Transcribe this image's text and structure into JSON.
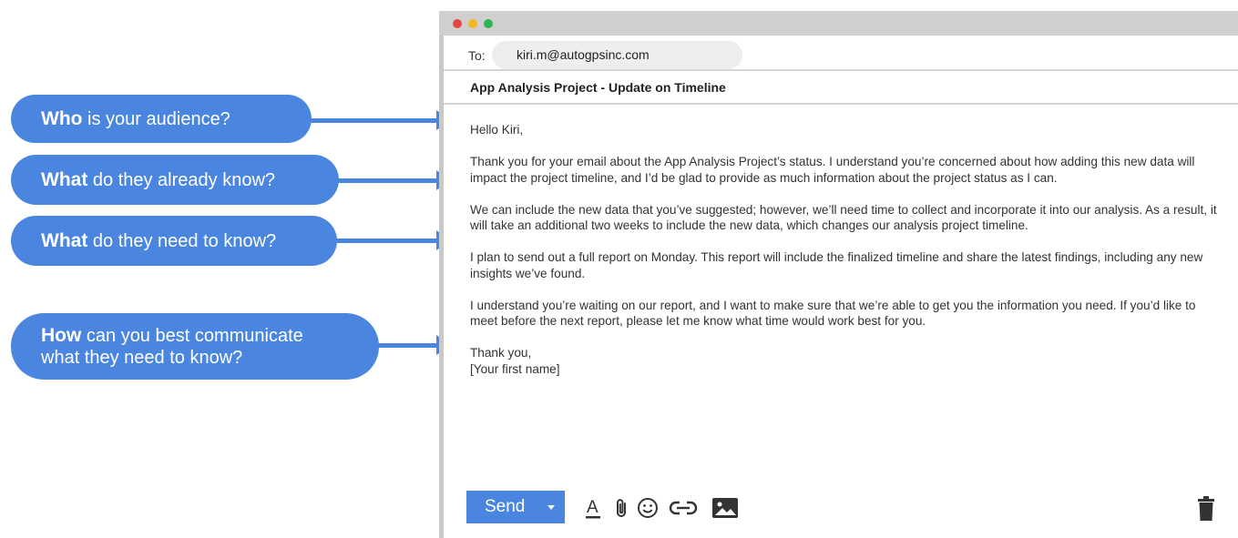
{
  "callouts": [
    {
      "bold": "Who",
      "rest": " is your audience?"
    },
    {
      "bold": "What",
      "rest": " do they already know?"
    },
    {
      "bold": "What",
      "rest": " do they need to know?"
    },
    {
      "bold": "How",
      "rest": " can you best communicate",
      "line2": "what they need to know?"
    }
  ],
  "email": {
    "to_label": "To:",
    "to_address": "kiri.m@autogpsinc.com",
    "subject": "App Analysis Project - Update on Timeline",
    "greeting": "Hello Kiri,",
    "paragraphs": [
      "Thank you for your email about the App Analysis Project’s status. I understand you’re concerned about how adding this new data will impact the project timeline, and I’d be glad to provide as much information about the project status as I can.",
      "We can include the new data that you’ve suggested; however, we’ll need time to collect and incorporate it into our analysis. As a result, it will take an additional two weeks to include the new data, which changes our analysis project timeline.",
      "I plan to send out a full report on Monday. This report will include the finalized timeline and share the latest findings, including any new insights we’ve found.",
      "I understand you’re waiting on our report, and I want to make sure that we’re able to get you the information you need. If you’d like to meet before the next report, please let me know what time would work best for you."
    ],
    "closing": "Thank you,",
    "signature": "[Your first name]"
  },
  "toolbar": {
    "send_label": "Send",
    "icons": [
      "format-text-icon",
      "attach-icon",
      "emoji-icon",
      "link-icon",
      "insert-photo-icon",
      "trash-icon"
    ]
  },
  "colors": {
    "accent": "#4a86e0",
    "window_frame": "#cfcfcf",
    "close": "#e2463f",
    "minimize": "#f2b823",
    "maximize": "#2fb34b"
  }
}
